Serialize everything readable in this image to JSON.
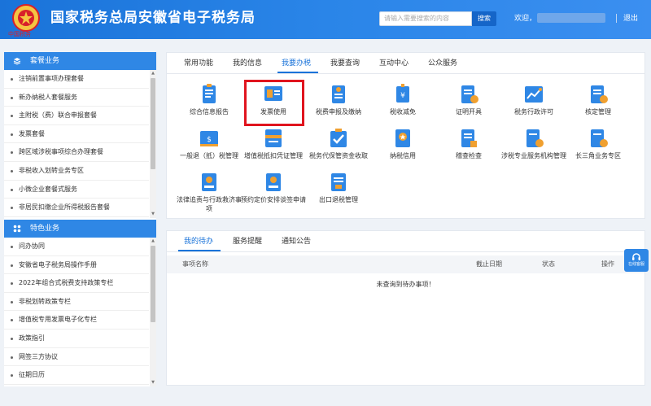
{
  "header": {
    "title": "国家税务总局安徽省电子税务局",
    "emblem_text": "中国税务",
    "search_placeholder": "请输入需要搜索的内容",
    "search_button": "搜索",
    "welcome": "欢迎，",
    "logout": "退出"
  },
  "left": {
    "group1": {
      "title": "套餐业务",
      "items": [
        "注销前置事项办理套餐",
        "新办纳税人套餐服务",
        "主附税（费）联合申报套餐",
        "发票套餐",
        "跨区域涉税事项综合办理套餐",
        "非税收入划转业务专区",
        "小微企业套餐式服务",
        "非居民扣缴企业所得税报告套餐"
      ]
    },
    "group2": {
      "title": "特色业务",
      "items": [
        "问办协同",
        "安徽省电子税务局操作手册",
        "2022年组合式税费支持政策专栏",
        "非税划转政策专栏",
        "增值税专用发票电子化专栏",
        "政策指引",
        "网签三方协议",
        "征期日历"
      ]
    }
  },
  "tabs": [
    "常用功能",
    "我的信息",
    "我要办税",
    "我要查询",
    "互动中心",
    "公众服务"
  ],
  "active_tab": "我要办税",
  "functions": [
    {
      "label": "综合信息报告",
      "icon": "report-icon"
    },
    {
      "label": "发票使用",
      "icon": "invoice-icon"
    },
    {
      "label": "税费申报及缴纳",
      "icon": "declare-icon"
    },
    {
      "label": "税收减免",
      "icon": "tax-relief-icon"
    },
    {
      "label": "证明开具",
      "icon": "certificate-icon"
    },
    {
      "label": "税务行政许可",
      "icon": "license-icon"
    },
    {
      "label": "核定管理",
      "icon": "assessment-icon"
    },
    {
      "label": "一般退（抵）税管理",
      "icon": "refund-icon"
    },
    {
      "label": "增值税抵扣凭证管理",
      "icon": "voucher-icon"
    },
    {
      "label": "税务代保管资金收取",
      "icon": "custody-icon"
    },
    {
      "label": "纳税信用",
      "icon": "credit-icon"
    },
    {
      "label": "稽查检查",
      "icon": "inspection-icon"
    },
    {
      "label": "涉税专业服务机构管理",
      "icon": "agency-icon"
    },
    {
      "label": "长三角业务专区",
      "icon": "yangtze-icon"
    },
    {
      "label": "法律追责与行政救济事项",
      "icon": "law-icon"
    },
    {
      "label": "预约定价安排谈签申请",
      "icon": "pricing-icon"
    },
    {
      "label": "出口退税管理",
      "icon": "export-icon"
    }
  ],
  "todo": {
    "tabs": [
      "我的待办",
      "服务提醒",
      "通知公告"
    ],
    "active_tab": "我的待办",
    "columns": [
      "事项名称",
      "截止日期",
      "状态",
      "操作"
    ],
    "empty": "未查询到待办事项！"
  },
  "help_button": "在线客服",
  "colors": {
    "primary": "#1a73d9",
    "header": "#2a85e8",
    "highlight": "#e0141e",
    "accent_orange": "#f0a030"
  }
}
